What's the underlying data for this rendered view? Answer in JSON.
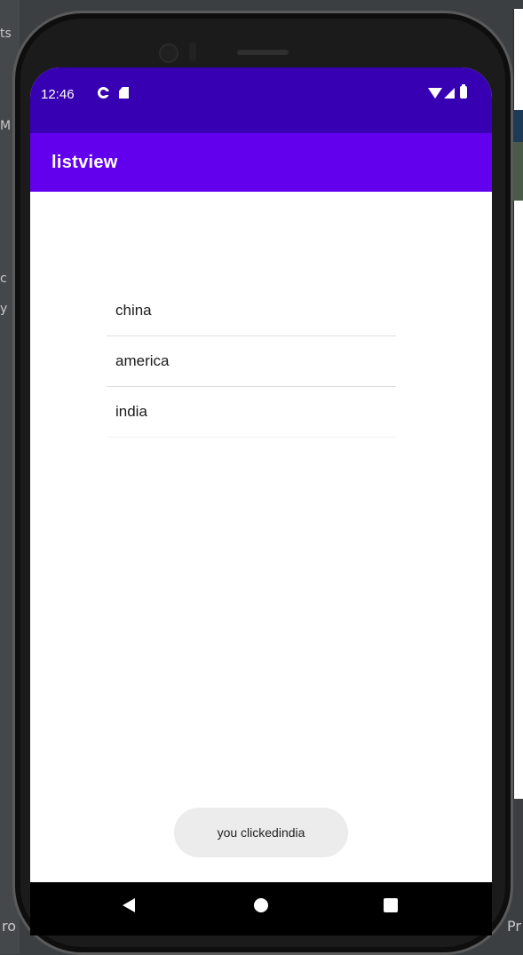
{
  "ide": {
    "left_fragments": [
      "ts",
      "M",
      "c",
      "y"
    ],
    "bottom_left_fragment": "ro",
    "bottom_right_fragment": "Pr"
  },
  "status_bar": {
    "time": "12:46",
    "icons": [
      "google-icon",
      "sd-card-icon",
      "wifi-icon",
      "signal-icon",
      "battery-icon"
    ],
    "color": "#3700b3"
  },
  "app_bar": {
    "title": "listview",
    "color": "#6200ee"
  },
  "list": {
    "items": [
      {
        "label": "china"
      },
      {
        "label": "america"
      },
      {
        "label": "india"
      }
    ]
  },
  "toast": {
    "text": "you clickedindia"
  },
  "nav_bar": {
    "buttons": [
      "back-icon",
      "home-icon",
      "recents-icon"
    ]
  }
}
